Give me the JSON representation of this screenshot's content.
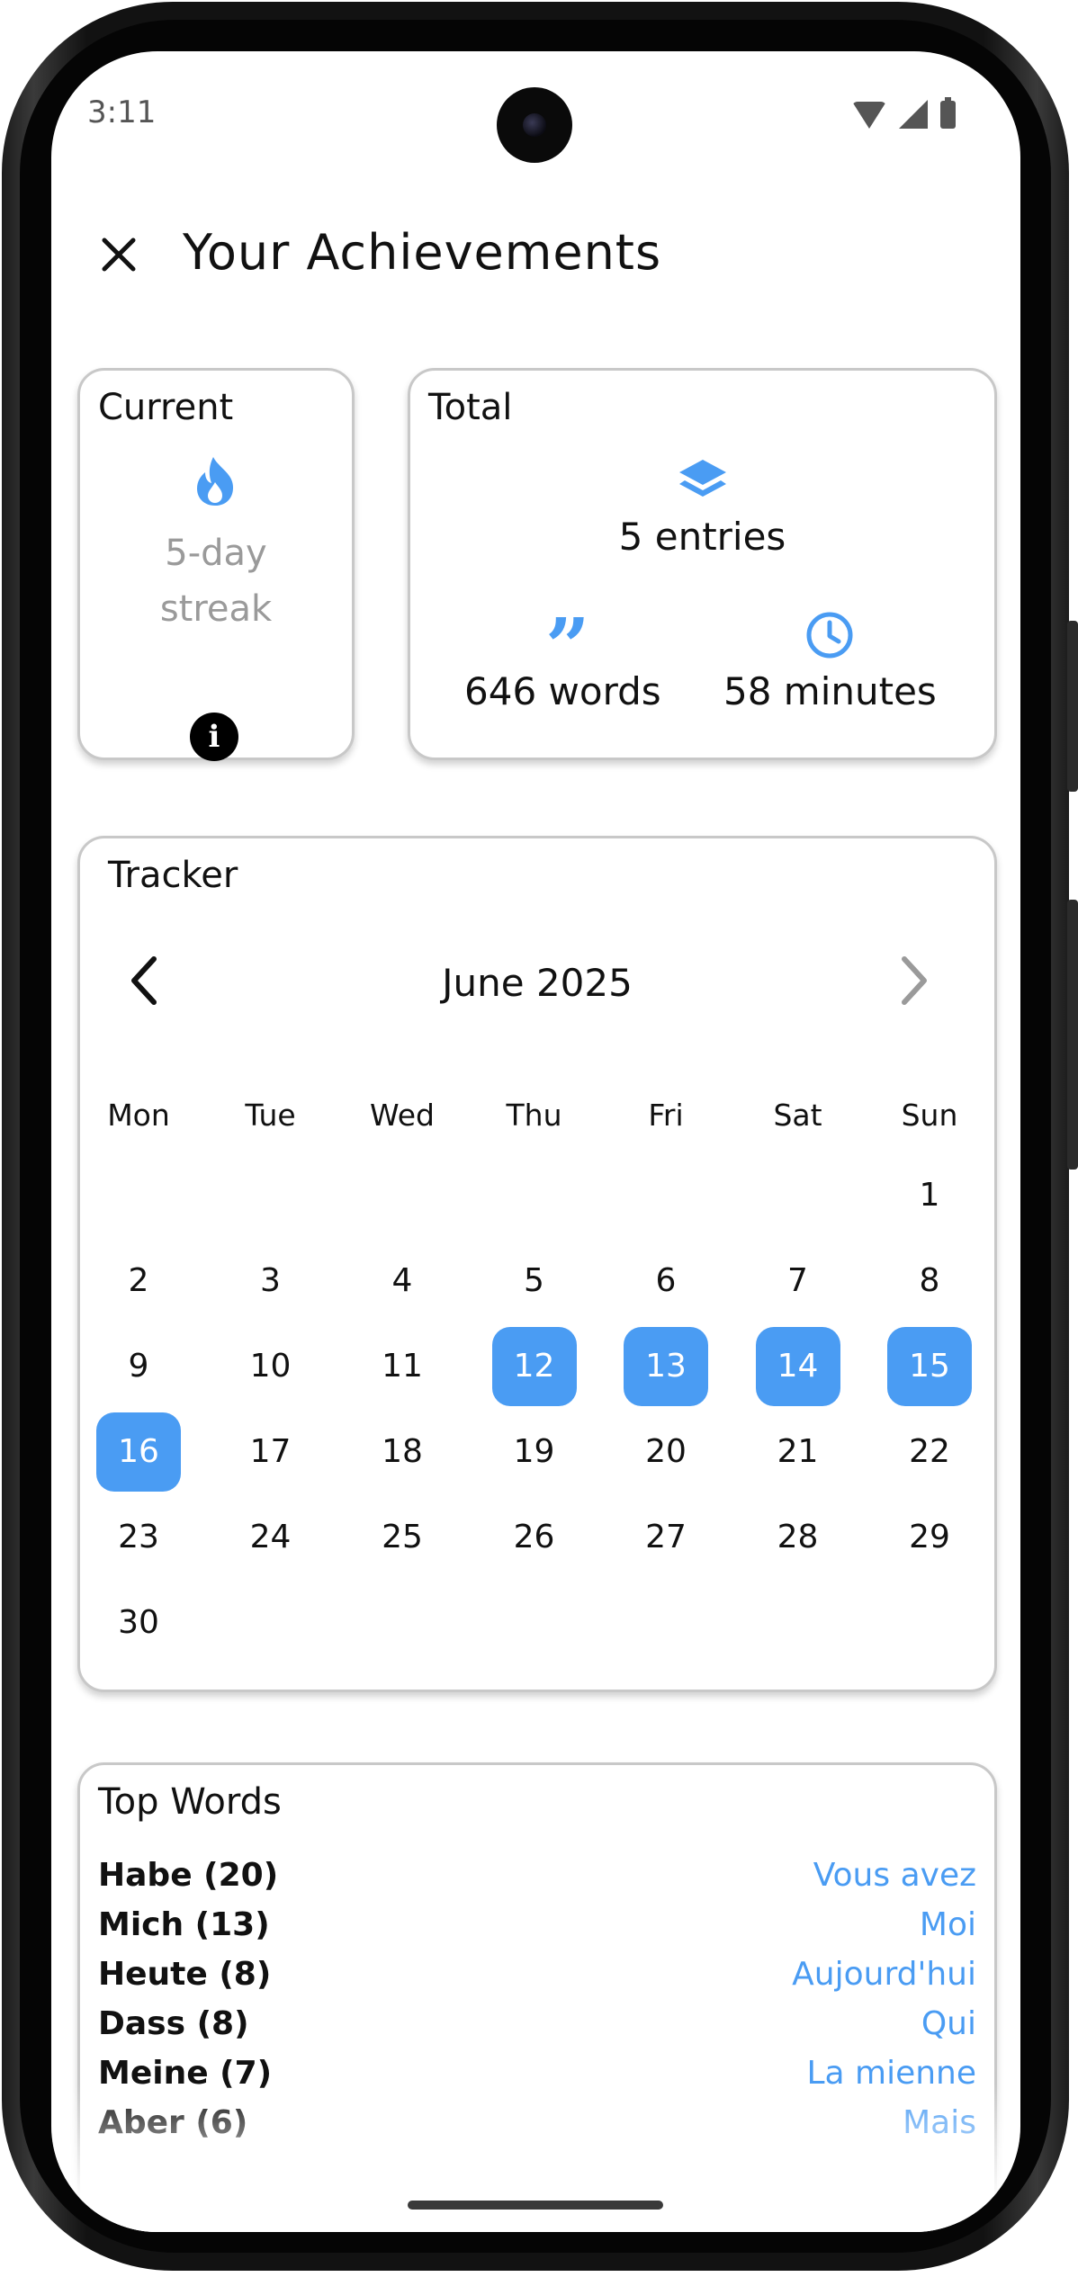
{
  "status_bar": {
    "time": "3:11"
  },
  "header": {
    "title": "Your Achievements",
    "close_icon": "close-icon"
  },
  "current": {
    "title": "Current",
    "streak_line1": "5-day",
    "streak_line2": "streak",
    "icon": "flame-icon",
    "info_icon": "info-icon",
    "info_glyph": "i"
  },
  "total": {
    "title": "Total",
    "entries": "5 entries",
    "words": "646 words",
    "minutes": "58 minutes",
    "icons": [
      "layers-icon",
      "quote-icon",
      "clock-icon"
    ],
    "quote_glyph": "”"
  },
  "tracker": {
    "title": "Tracker",
    "month": "June 2025",
    "weekdays": [
      "Mon",
      "Tue",
      "Wed",
      "Thu",
      "Fri",
      "Sat",
      "Sun"
    ],
    "first_weekday_index": 6,
    "days_in_month": 30,
    "highlighted_days": [
      12,
      13,
      14,
      15,
      16
    ],
    "prev_enabled": true,
    "next_enabled": false
  },
  "top_words": {
    "title": "Top Words",
    "items": [
      {
        "word": "Habe (20)",
        "translation": "Vous avez"
      },
      {
        "word": "Mich (13)",
        "translation": "Moi"
      },
      {
        "word": "Heute (8)",
        "translation": "Aujourd'hui"
      },
      {
        "word": "Dass (8)",
        "translation": "Qui"
      },
      {
        "word": "Meine (7)",
        "translation": "La mienne"
      },
      {
        "word": "Aber (6)",
        "translation": "Mais"
      }
    ]
  },
  "colors": {
    "accent": "#4a9cf3",
    "muted": "#9a9a9a",
    "card_border": "#c8c8c8"
  }
}
